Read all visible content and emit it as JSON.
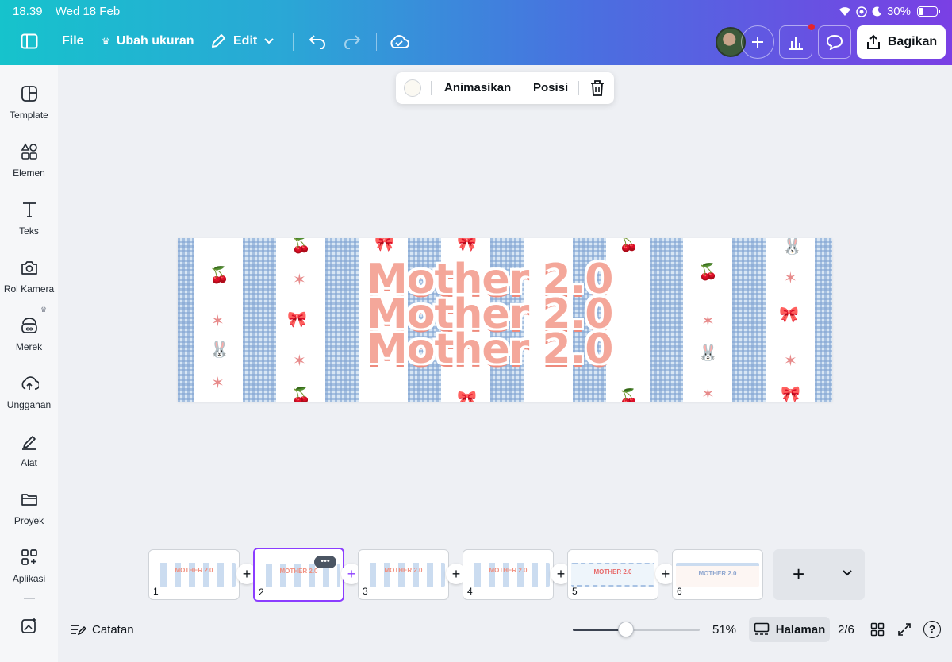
{
  "status_bar": {
    "time": "18.39",
    "date": "Wed 18 Feb",
    "battery": "30%",
    "battery_level": 0.3
  },
  "topbar": {
    "file_label": "File",
    "resize_label": "Ubah ukuran",
    "edit_label": "Edit",
    "share_label": "Bagikan"
  },
  "sidebar": {
    "items": [
      {
        "label": "Template",
        "icon": "template-icon"
      },
      {
        "label": "Elemen",
        "icon": "elements-icon"
      },
      {
        "label": "Teks",
        "icon": "text-icon"
      },
      {
        "label": "Rol Kamera",
        "icon": "camera-icon"
      },
      {
        "label": "Merek",
        "icon": "brand-icon"
      },
      {
        "label": "Unggahan",
        "icon": "upload-icon"
      },
      {
        "label": "Alat",
        "icon": "tools-icon"
      },
      {
        "label": "Proyek",
        "icon": "folder-icon"
      },
      {
        "label": "Aplikasi",
        "icon": "apps-icon"
      }
    ]
  },
  "floating_toolbar": {
    "animate_label": "Animasikan",
    "position_label": "Posisi",
    "swatch_color": "#fbf9f2"
  },
  "canvas": {
    "title_lines": [
      "Mother 2.0",
      "Mother 2.0",
      "Mother 2.0"
    ],
    "colors": {
      "title": "#f4a79a",
      "gingham": "#a9c3e4",
      "accent": "#e78a8a"
    }
  },
  "pages": {
    "thumbnails": [
      {
        "number": "1",
        "text": "MOTHER 2.0"
      },
      {
        "number": "2",
        "text": "MOTHER 2.0",
        "active": true,
        "more": "•••"
      },
      {
        "number": "3",
        "text": "MOTHER 2.0"
      },
      {
        "number": "4",
        "text": "MOTHER 2.0"
      },
      {
        "number": "5",
        "text": "MOTHER 2.0"
      },
      {
        "number": "6",
        "text": "MOTHER 2.0"
      }
    ],
    "add_symbol": "+",
    "expand_symbol": "⌄"
  },
  "bottom_bar": {
    "notes_label": "Catatan",
    "zoom": "51%",
    "zoom_fraction": 0.42,
    "pages_label": "Halaman",
    "page_counter": "2/6",
    "help": "?"
  },
  "accent_color": "#8b3dff"
}
